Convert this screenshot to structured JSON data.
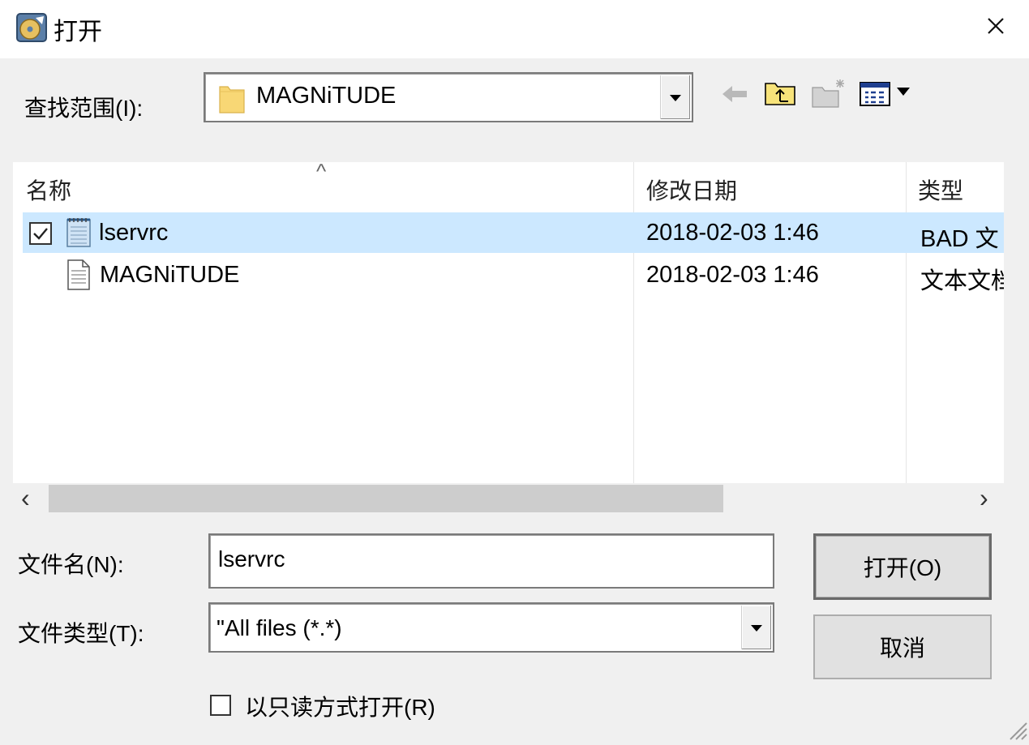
{
  "window": {
    "title": "打开",
    "close_icon": "close-icon",
    "app_icon": "disc-app-icon"
  },
  "lookin": {
    "label": "查找范围(I):",
    "value": "MAGNiTUDE",
    "folder_icon": "folder-icon"
  },
  "toolbar": {
    "back_icon": "back-arrow-icon",
    "up_icon": "folder-up-icon",
    "new_folder_icon": "new-folder-icon",
    "view_menu_icon": "view-menu-icon"
  },
  "file_list": {
    "columns": [
      "名称",
      "修改日期",
      "类型"
    ],
    "sort_indicator": "^",
    "rows": [
      {
        "name": "lservrc",
        "modified": "2018-02-03 1:46",
        "type": "BAD 文",
        "selected": true,
        "checked": true,
        "icon": "notepad-file-icon"
      },
      {
        "name": "MAGNiTUDE",
        "modified": "2018-02-03 1:46",
        "type": "文本文档",
        "selected": false,
        "checked": false,
        "icon": "text-file-icon"
      }
    ]
  },
  "scrollbar": {
    "left_arrow": "‹",
    "right_arrow": "›"
  },
  "filename": {
    "label": "文件名(N):",
    "value": "lservrc"
  },
  "filetype": {
    "label": "文件类型(T):",
    "value": "\"All files (*.*)"
  },
  "buttons": {
    "open": "打开(O)",
    "cancel": "取消"
  },
  "readonly": {
    "label": "以只读方式打开(R)",
    "checked": false
  }
}
